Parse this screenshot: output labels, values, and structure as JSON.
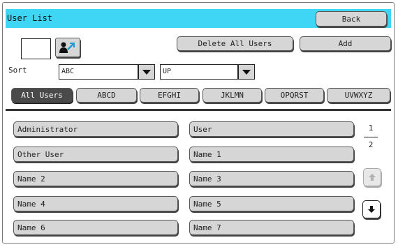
{
  "title": "User List",
  "back_label": "Back",
  "delete_all_label": "Delete All Users",
  "add_label": "Add",
  "sort": {
    "label": "Sort",
    "order_value": "ABC",
    "direction_value": "UP"
  },
  "tabs": [
    "All Users",
    "ABCD",
    "EFGHI",
    "JKLMN",
    "OPQRST",
    "UVWXYZ"
  ],
  "users": [
    "Administrator",
    "User",
    "Other User",
    "Name 1",
    "Name 2",
    "Name 3",
    "Name 4",
    "Name 5",
    "Name 6",
    "Name 7"
  ],
  "page": {
    "current": "1",
    "total": "2"
  }
}
